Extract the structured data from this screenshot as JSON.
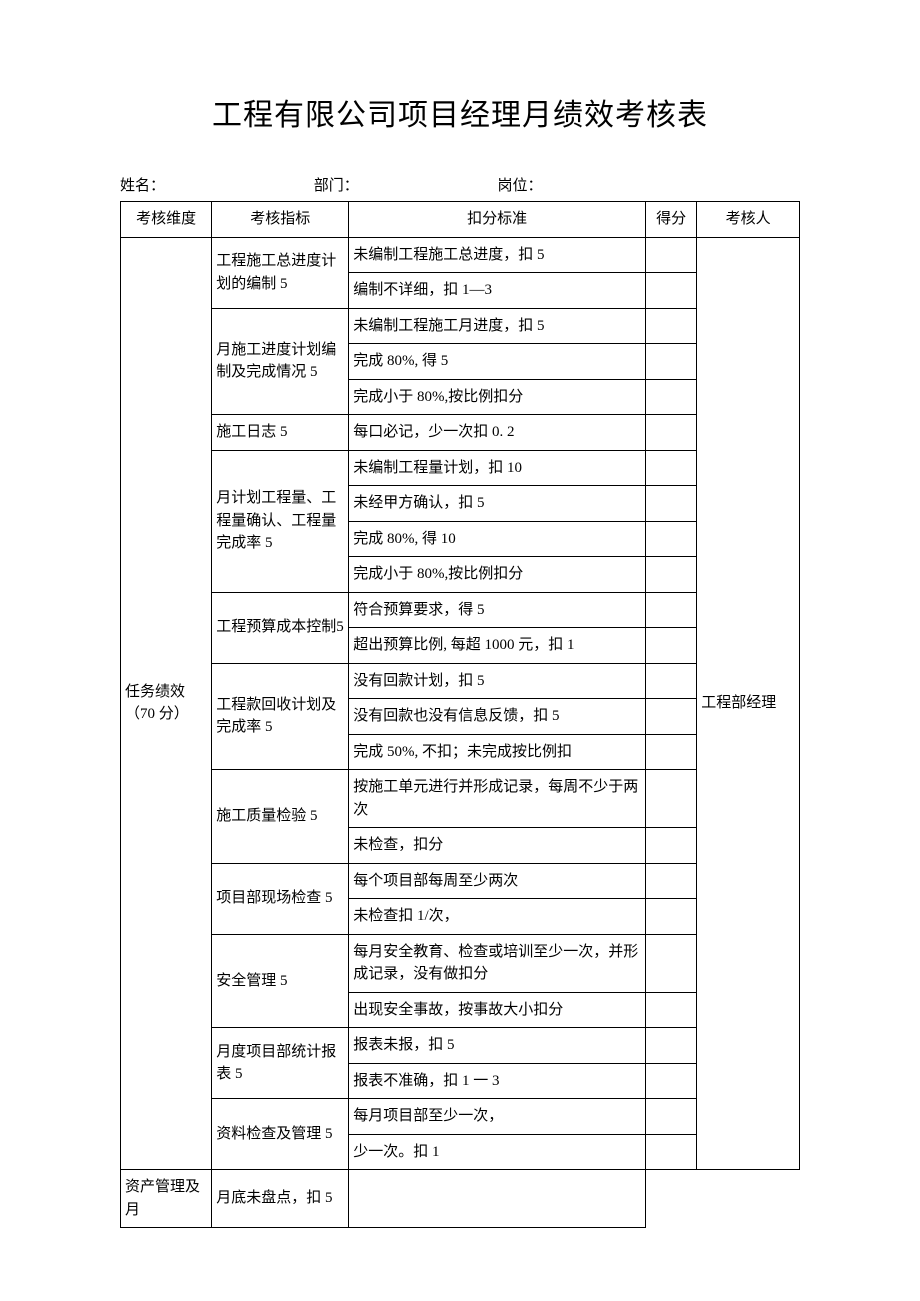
{
  "title": "工程有限公司项目经理月绩效考核表",
  "meta": {
    "name_label": "姓名：",
    "dept_label": "部门：",
    "post_label": "岗位："
  },
  "headers": {
    "dimension": "考核维度",
    "metric": "考核指标",
    "standard": "扣分标准",
    "score": "得分",
    "evaluator": "考核人"
  },
  "dimension": "任务绩效（70 分）",
  "evaluator": "工程部经理",
  "metrics": {
    "m1": "工程施工总进度计划的编制 5",
    "m2": "月施工进度计划编制及完成情况 5",
    "m3": "施工日志 5",
    "m4": "月计划工程量、工程量确认、工程量完成率 5",
    "m5": "工程预算成本控制5",
    "m6": "工程款回收计划及完成率 5",
    "m7": "施工质量检验 5",
    "m8": "项目部现场检查 5",
    "m9": "安全管理 5",
    "m10": "月度项目部统计报表 5",
    "m11": "资料检查及管理 5",
    "m12": "资产管理及月"
  },
  "standards": {
    "s1a": "未编制工程施工总进度，扣 5",
    "s1b": "编制不详细，扣 1—3",
    "s2a": "未编制工程施工月进度，扣 5",
    "s2b": "完成 80%, 得 5",
    "s2c": "完成小于 80%,按比例扣分",
    "s3a": "每口必记，少一次扣 0. 2",
    "s4a": "未编制工程量计划，扣 10",
    "s4b": "未经甲方确认，扣 5",
    "s4c": "完成 80%, 得 10",
    "s4d": "完成小于 80%,按比例扣分",
    "s5a": "符合预算要求，得 5",
    "s5b": "超出预算比例, 每超 1000 元，扣 1",
    "s6a": "没有回款计划，扣 5",
    "s6b": "没有回款也没有信息反馈，扣 5",
    "s6c": "完成 50%, 不扣；未完成按比例扣",
    "s7a": "按施工单元进行并形成记录，每周不少于两次",
    "s7b": "未检查，扣分",
    "s8a": "每个项目部每周至少两次",
    "s8b": "未检查扣 1/次，",
    "s9a": "每月安全教育、检查或培训至少一次，并形成记录，没有做扣分",
    "s9b": "出现安全事故，按事故大小扣分",
    "s10a": "报表未报，扣 5",
    "s10b": "报表不准确，扣 1 一 3",
    "s11a": "每月项目部至少一次，",
    "s11b": "少一次。扣 1",
    "s12a": "月底未盘点，扣 5"
  }
}
